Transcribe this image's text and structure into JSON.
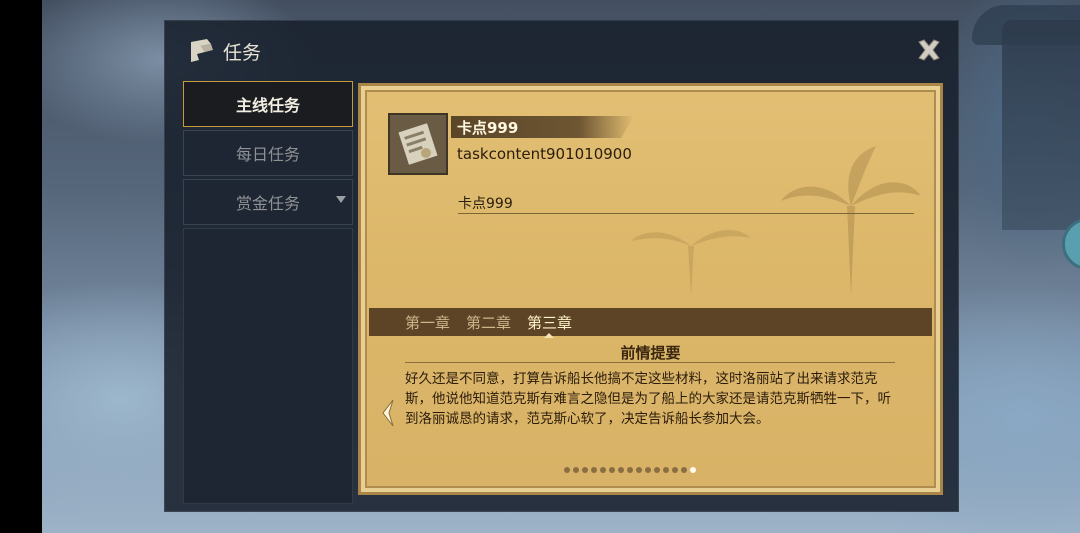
{
  "window": {
    "title": "任务"
  },
  "tabs": [
    {
      "label": "主线任务",
      "active": true
    },
    {
      "label": "每日任务",
      "active": false
    },
    {
      "label": "赏金任务",
      "active": false,
      "has_dropdown": true
    }
  ],
  "quest": {
    "title": "卡点999",
    "content": "taskcontent901010900",
    "sub_item": "卡点999",
    "icon": "scroll-icon"
  },
  "chapters": [
    {
      "label": "第一章",
      "active": false
    },
    {
      "label": "第二章",
      "active": false
    },
    {
      "label": "第三章",
      "active": true
    }
  ],
  "recap": {
    "title": "前情提要",
    "text": "好久还是不同意，打算告诉船长他搞不定这些材料，这时洛丽站了出来请求范克斯，他说他知道范克斯有难言之隐但是为了船上的大家还是请范克斯牺牲一下，听到洛丽诚恳的请求，范克斯心软了，决定告诉船长参加大会。"
  },
  "pagination": {
    "total": 15,
    "current": 15
  },
  "colors": {
    "accent": "#c99a3c",
    "parchment": "#dcb76a",
    "chapter_bar": "#5d4427"
  }
}
